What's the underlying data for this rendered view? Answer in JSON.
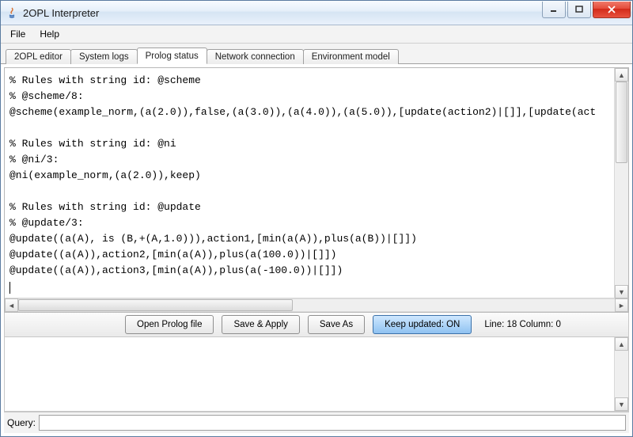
{
  "window": {
    "title": "2OPL Interpreter"
  },
  "menu": {
    "file": "File",
    "help": "Help"
  },
  "tabs": [
    {
      "label": "2OPL editor"
    },
    {
      "label": "System logs"
    },
    {
      "label": "Prolog status"
    },
    {
      "label": "Network connection"
    },
    {
      "label": "Environment model"
    }
  ],
  "editor_text": "% Rules with string id: @scheme\n% @scheme/8:\n@scheme(example_norm,(a(2.0)),false,(a(3.0)),(a(4.0)),(a(5.0)),[update(action2)|[]],[update(act\n\n% Rules with string id: @ni\n% @ni/3:\n@ni(example_norm,(a(2.0)),keep)\n\n% Rules with string id: @update\n% @update/3:\n@update((a(A), is (B,+(A,1.0))),action1,[min(a(A)),plus(a(B))|[]])\n@update((a(A)),action2,[min(a(A)),plus(a(100.0))|[]])\n@update((a(A)),action3,[min(a(A)),plus(a(-100.0))|[]])\n",
  "buttons": {
    "open": "Open Prolog file",
    "save_apply": "Save & Apply",
    "save_as": "Save As",
    "keep_updated": "Keep updated:  ON"
  },
  "status": {
    "cursor": "Line: 18 Column: 0"
  },
  "query": {
    "label": "Query:",
    "value": ""
  }
}
